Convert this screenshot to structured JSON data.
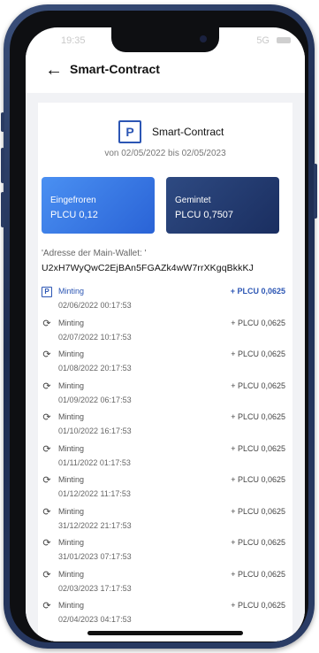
{
  "status": {
    "time": "19:35",
    "network": "5G"
  },
  "header": {
    "back_icon": "arrow-left-icon",
    "title": "Smart-Contract"
  },
  "contract": {
    "icon": "contract-logo-icon",
    "logo_glyph": "P",
    "title": "Smart-Contract",
    "period": "von 02/05/2022 bis 02/05/2023"
  },
  "tiles": {
    "frozen": {
      "label": "Eingefroren",
      "value": "PLCU 0,12",
      "color": "#3a7ee8"
    },
    "minted": {
      "label": "Gemintet",
      "value": "PLCU 0,7507",
      "color": "#22376c"
    }
  },
  "wallet": {
    "label": "'Adresse der Main-Wallet: '",
    "address": "U2xH7WyQwC2EjBAn5FGAZk4wW7rrXKgqBkkKJ"
  },
  "accent_color": "#2c56b4",
  "transactions": [
    {
      "name": "Minting",
      "date": "02/06/2022 00:17:53",
      "amount": "+ PLCU 0,0625",
      "icon": "contract-logo-icon"
    },
    {
      "name": "Minting",
      "date": "02/07/2022 10:17:53",
      "amount": "+ PLCU 0,0625",
      "icon": "sync-icon"
    },
    {
      "name": "Minting",
      "date": "01/08/2022 20:17:53",
      "amount": "+ PLCU 0,0625",
      "icon": "sync-icon"
    },
    {
      "name": "Minting",
      "date": "01/09/2022 06:17:53",
      "amount": "+ PLCU 0,0625",
      "icon": "sync-icon"
    },
    {
      "name": "Minting",
      "date": "01/10/2022 16:17:53",
      "amount": "+ PLCU 0,0625",
      "icon": "sync-icon"
    },
    {
      "name": "Minting",
      "date": "01/11/2022 01:17:53",
      "amount": "+ PLCU 0,0625",
      "icon": "sync-icon"
    },
    {
      "name": "Minting",
      "date": "01/12/2022 11:17:53",
      "amount": "+ PLCU 0,0625",
      "icon": "sync-icon"
    },
    {
      "name": "Minting",
      "date": "31/12/2022 21:17:53",
      "amount": "+ PLCU 0,0625",
      "icon": "sync-icon"
    },
    {
      "name": "Minting",
      "date": "31/01/2023 07:17:53",
      "amount": "+ PLCU 0,0625",
      "icon": "sync-icon"
    },
    {
      "name": "Minting",
      "date": "02/03/2023 17:17:53",
      "amount": "+ PLCU 0,0625",
      "icon": "sync-icon"
    },
    {
      "name": "Minting",
      "date": "02/04/2023 04:17:53",
      "amount": "+ PLCU 0,0625",
      "icon": "sync-icon"
    }
  ]
}
